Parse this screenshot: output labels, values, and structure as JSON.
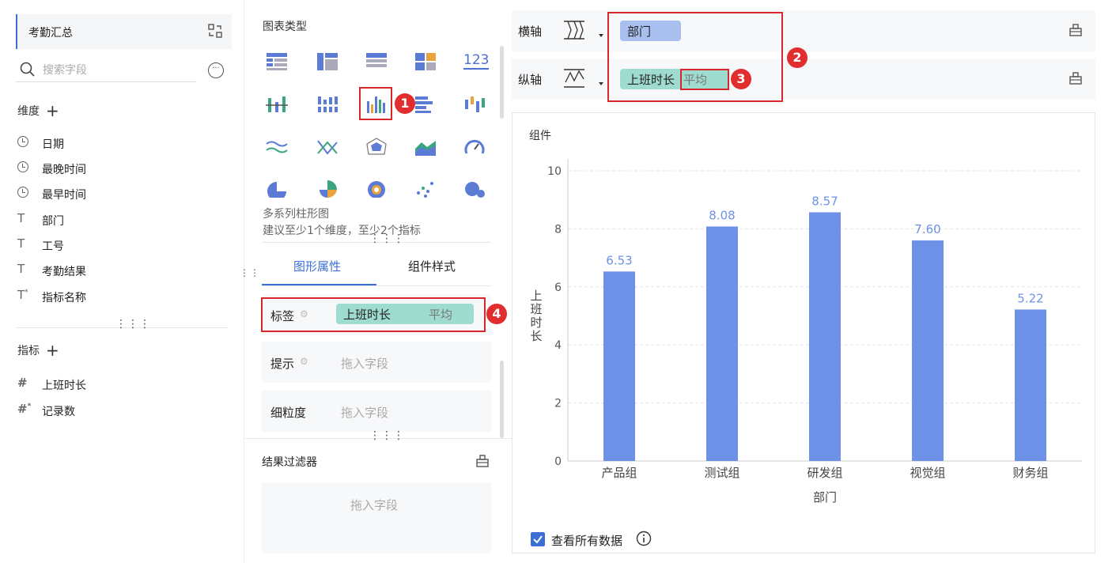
{
  "left": {
    "title": "考勤汇总",
    "search_placeholder": "搜索字段",
    "dimensions_label": "维度",
    "dimensions": [
      {
        "label": "日期",
        "icon": "clock-icon"
      },
      {
        "label": "最晚时间",
        "icon": "clock-icon"
      },
      {
        "label": "最早时间",
        "icon": "clock-icon"
      },
      {
        "label": "部门",
        "icon": "text-icon"
      },
      {
        "label": "工号",
        "icon": "text-icon"
      },
      {
        "label": "考勤结果",
        "icon": "text-icon"
      },
      {
        "label": "指标名称",
        "icon": "text-calc-icon"
      }
    ],
    "metrics_label": "指标",
    "metrics": [
      {
        "label": "上班时长",
        "icon": "hash-icon"
      },
      {
        "label": "记录数",
        "icon": "hash-calc-icon"
      }
    ]
  },
  "middle": {
    "chart_type_title": "图表类型",
    "chart_type_name": "多系列柱形图",
    "chart_type_hint": "建议至少1个维度，至少2个指标",
    "tabs": [
      "图形属性",
      "组件样式"
    ],
    "props": {
      "label_name": "标签",
      "label_field": "上班时长",
      "label_agg": "平均",
      "tooltip_name": "提示",
      "tooltip_placeholder": "拖入字段",
      "granularity_name": "细粒度",
      "granularity_placeholder": "拖入字段"
    },
    "filter_title": "结果过滤器",
    "filter_placeholder": "拖入字段"
  },
  "axes": {
    "x_label": "横轴",
    "x_field": "部门",
    "y_label": "纵轴",
    "y_field": "上班时长",
    "y_agg": "平均"
  },
  "badges": [
    "1",
    "2",
    "3",
    "4"
  ],
  "chart_panel": {
    "component_label": "组件",
    "view_all_label": "查看所有数据"
  },
  "colors": {
    "bar": "#6e91e8",
    "accent": "#3b6fd6",
    "pill": "#9fdcd0",
    "x_pill": "#a9bff0",
    "teal": "#2ba889",
    "red": "#e12d2d"
  },
  "chart_data": {
    "type": "bar",
    "categories": [
      "产品组",
      "测试组",
      "研发组",
      "视觉组",
      "财务组"
    ],
    "values": [
      6.53,
      8.08,
      8.57,
      7.6,
      5.22
    ],
    "value_labels": [
      "6.53",
      "8.08",
      "8.57",
      "7.60",
      "5.22"
    ],
    "xlabel": "部门",
    "ylabel": "上班时长",
    "ylim": [
      0,
      10
    ],
    "yticks": [
      "0",
      "2",
      "4",
      "6",
      "8",
      "10"
    ],
    "grid": true
  }
}
